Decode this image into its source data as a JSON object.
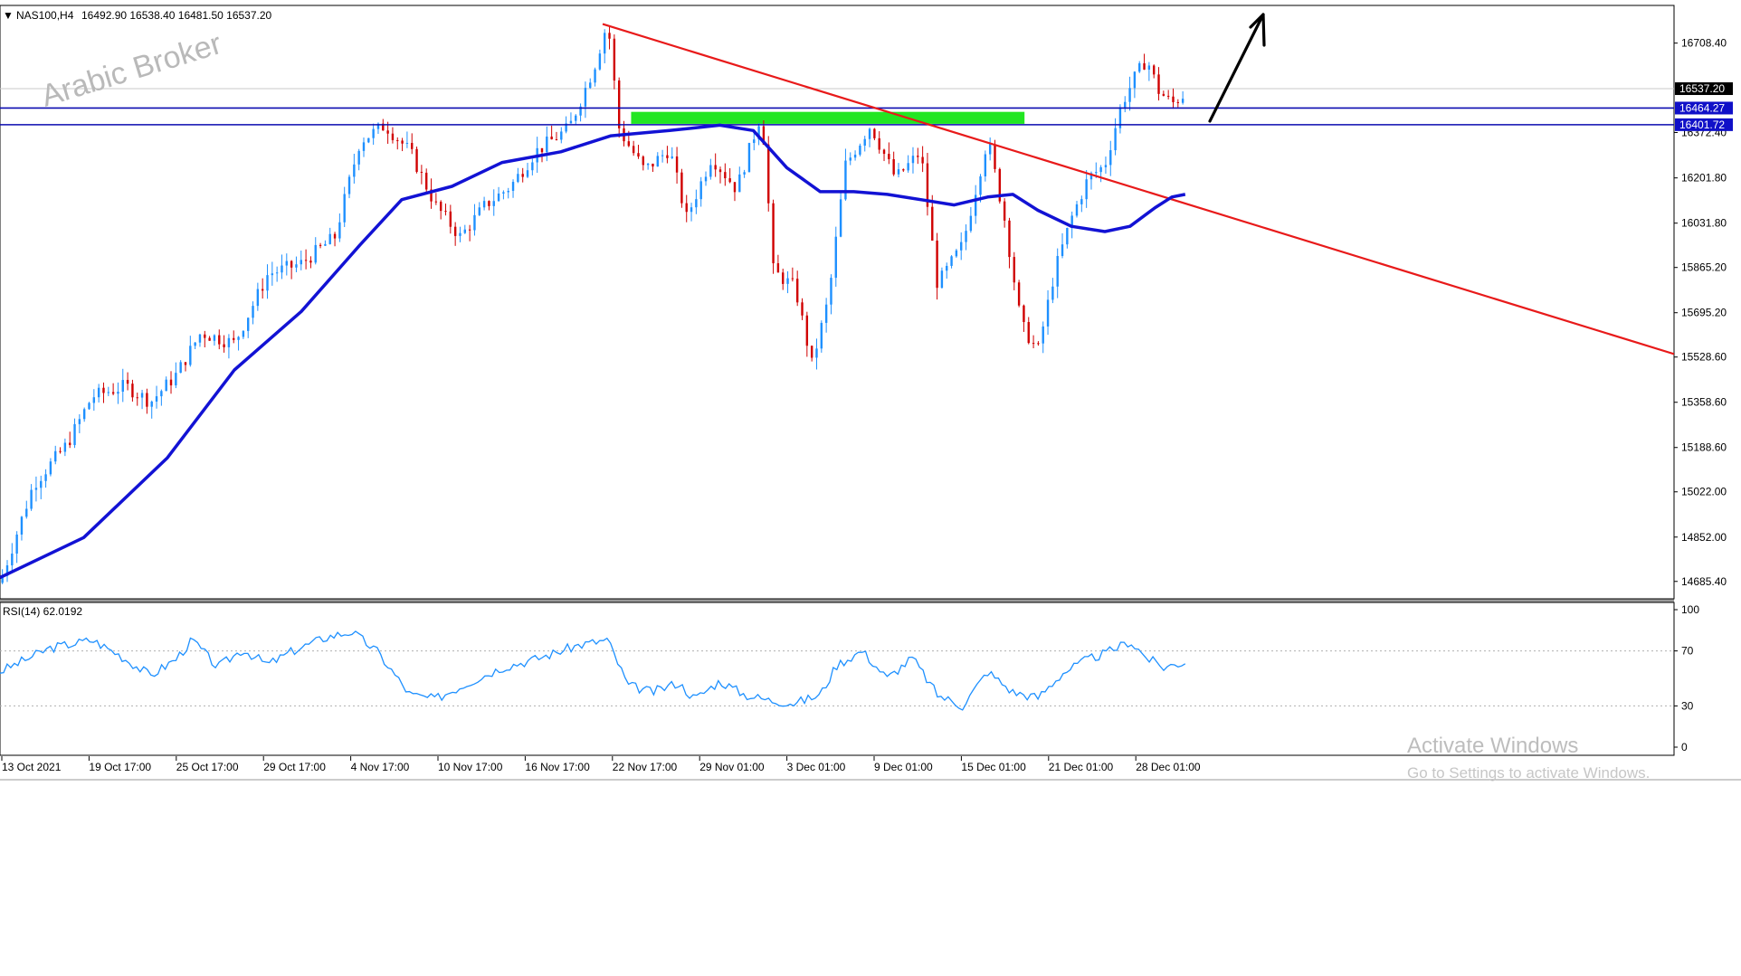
{
  "header": {
    "symbol": "NAS100,H4",
    "ohlc": "16492.90 16538.40 16481.50 16537.20"
  },
  "watermark": "Arabic Broker",
  "activate": {
    "line1": "Activate Windows",
    "line2": "Go to Settings to activate Windows."
  },
  "colors": {
    "bull": "#1e90ff",
    "bear": "#d00000",
    "ma": "#1212d4",
    "trendline": "#e81a1a",
    "levels": "#0b0bb0",
    "zone": "#22e622",
    "rsi": "#1e90ff",
    "arrow": "#000000"
  },
  "chart_data": [
    {
      "type": "candlestick",
      "symbol": "NAS100",
      "timeframe": "H4",
      "open": 16492.9,
      "high": 16538.4,
      "low": 16481.5,
      "close": 16537.2,
      "ylim": [
        14620,
        16850
      ],
      "y_ticks": [
        "16708.40",
        "16372.40",
        "16201.80",
        "16031.80",
        "15865.20",
        "15695.20",
        "15528.60",
        "15358.60",
        "15188.60",
        "15022.00",
        "14852.00",
        "14685.40"
      ],
      "x_ticks": [
        "13 Oct 2021",
        "19 Oct 17:00",
        "25 Oct 17:00",
        "29 Oct 17:00",
        "4 Nov 17:00",
        "10 Nov 17:00",
        "16 Nov 17:00",
        "22 Nov 17:00",
        "29 Nov 01:00",
        "3 Dec 01:00",
        "9 Dec 01:00",
        "15 Dec 01:00",
        "21 Dec 01:00",
        "28 Dec 01:00"
      ],
      "current_price": "16537.20",
      "levels": [
        {
          "label": "16464.27",
          "value": 16464.27
        },
        {
          "label": "16401.72",
          "value": 16401.72
        }
      ],
      "indicator": "moving average",
      "annotations": {
        "resistance_zone": [
          16405,
          16450
        ],
        "trendline": {
          "from": [
            0.36,
            16780
          ],
          "to": [
            1.0,
            15540
          ]
        },
        "arrow": "up"
      },
      "price_path": [
        [
          0.0,
          14680
        ],
        [
          0.02,
          15050
        ],
        [
          0.04,
          15200
        ],
        [
          0.055,
          15380
        ],
        [
          0.075,
          15420
        ],
        [
          0.09,
          15360
        ],
        [
          0.105,
          15460
        ],
        [
          0.12,
          15620
        ],
        [
          0.14,
          15580
        ],
        [
          0.16,
          15840
        ],
        [
          0.18,
          15880
        ],
        [
          0.2,
          15980
        ],
        [
          0.215,
          16340
        ],
        [
          0.23,
          16400
        ],
        [
          0.245,
          16300
        ],
        [
          0.26,
          16100
        ],
        [
          0.275,
          15980
        ],
        [
          0.29,
          16100
        ],
        [
          0.305,
          16170
        ],
        [
          0.32,
          16300
        ],
        [
          0.34,
          16390
        ],
        [
          0.355,
          16620
        ],
        [
          0.363,
          16790
        ],
        [
          0.37,
          16380
        ],
        [
          0.385,
          16230
        ],
        [
          0.4,
          16310
        ],
        [
          0.41,
          16050
        ],
        [
          0.425,
          16280
        ],
        [
          0.44,
          16160
        ],
        [
          0.455,
          16450
        ],
        [
          0.462,
          15850
        ],
        [
          0.475,
          15790
        ],
        [
          0.485,
          15500
        ],
        [
          0.495,
          15750
        ],
        [
          0.505,
          16250
        ],
        [
          0.52,
          16400
        ],
        [
          0.535,
          16200
        ],
        [
          0.55,
          16300
        ],
        [
          0.56,
          15800
        ],
        [
          0.575,
          15950
        ],
        [
          0.59,
          16350
        ],
        [
          0.6,
          16050
        ],
        [
          0.61,
          15650
        ],
        [
          0.62,
          15550
        ],
        [
          0.63,
          15850
        ],
        [
          0.64,
          16050
        ],
        [
          0.65,
          16200
        ],
        [
          0.66,
          16250
        ],
        [
          0.67,
          16480
        ],
        [
          0.678,
          16580
        ],
        [
          0.685,
          16650
        ],
        [
          0.692,
          16530
        ],
        [
          0.7,
          16480
        ],
        [
          0.708,
          16520
        ]
      ],
      "ma_path": [
        [
          0.0,
          14700
        ],
        [
          0.05,
          14850
        ],
        [
          0.1,
          15150
        ],
        [
          0.14,
          15480
        ],
        [
          0.18,
          15700
        ],
        [
          0.215,
          15950
        ],
        [
          0.24,
          16120
        ],
        [
          0.27,
          16170
        ],
        [
          0.3,
          16260
        ],
        [
          0.335,
          16300
        ],
        [
          0.365,
          16360
        ],
        [
          0.4,
          16380
        ],
        [
          0.43,
          16400
        ],
        [
          0.45,
          16380
        ],
        [
          0.47,
          16240
        ],
        [
          0.49,
          16150
        ],
        [
          0.51,
          16150
        ],
        [
          0.53,
          16140
        ],
        [
          0.55,
          16120
        ],
        [
          0.57,
          16100
        ],
        [
          0.59,
          16130
        ],
        [
          0.605,
          16140
        ],
        [
          0.62,
          16080
        ],
        [
          0.64,
          16020
        ],
        [
          0.66,
          16000
        ],
        [
          0.675,
          16020
        ],
        [
          0.69,
          16090
        ],
        [
          0.7,
          16130
        ],
        [
          0.708,
          16140
        ]
      ]
    },
    {
      "type": "line",
      "name": "RSI(14) 62.0192",
      "ylim": [
        0,
        100
      ],
      "y_ticks": [
        100,
        70,
        30,
        0
      ],
      "levels": [
        70,
        30
      ],
      "values_path": [
        [
          0.0,
          55
        ],
        [
          0.03,
          72
        ],
        [
          0.055,
          78
        ],
        [
          0.07,
          68
        ],
        [
          0.09,
          52
        ],
        [
          0.105,
          64
        ],
        [
          0.115,
          78
        ],
        [
          0.13,
          58
        ],
        [
          0.145,
          71
        ],
        [
          0.16,
          60
        ],
        [
          0.175,
          70
        ],
        [
          0.195,
          80
        ],
        [
          0.21,
          84
        ],
        [
          0.225,
          70
        ],
        [
          0.245,
          38
        ],
        [
          0.26,
          35
        ],
        [
          0.28,
          47
        ],
        [
          0.3,
          58
        ],
        [
          0.32,
          64
        ],
        [
          0.345,
          74
        ],
        [
          0.363,
          78
        ],
        [
          0.375,
          45
        ],
        [
          0.39,
          40
        ],
        [
          0.405,
          47
        ],
        [
          0.415,
          35
        ],
        [
          0.43,
          48
        ],
        [
          0.445,
          38
        ],
        [
          0.46,
          34
        ],
        [
          0.475,
          32
        ],
        [
          0.49,
          38
        ],
        [
          0.5,
          60
        ],
        [
          0.515,
          70
        ],
        [
          0.53,
          50
        ],
        [
          0.545,
          65
        ],
        [
          0.56,
          38
        ],
        [
          0.575,
          30
        ],
        [
          0.59,
          55
        ],
        [
          0.605,
          40
        ],
        [
          0.62,
          36
        ],
        [
          0.635,
          54
        ],
        [
          0.65,
          64
        ],
        [
          0.66,
          68
        ],
        [
          0.675,
          77
        ],
        [
          0.685,
          65
        ],
        [
          0.695,
          58
        ],
        [
          0.708,
          62
        ]
      ]
    }
  ]
}
